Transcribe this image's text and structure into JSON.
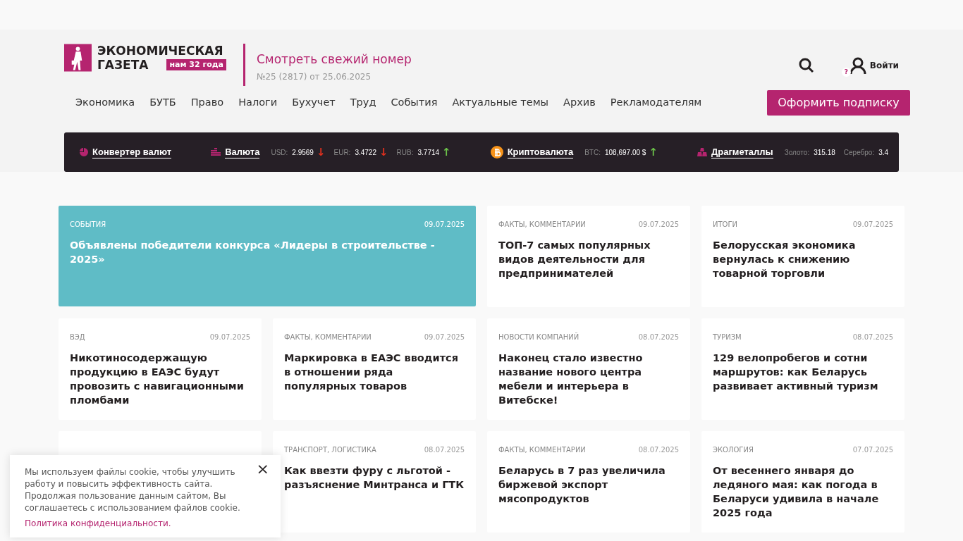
{
  "logo": {
    "line1": "ЭКОНОМИЧЕСКАЯ",
    "line2": "ГАЗЕТА",
    "badge": "нам 32 года"
  },
  "issue": {
    "link": "Смотреть свежий номер",
    "number": "№25 (2817) от 25.06.2025"
  },
  "login": {
    "label": "Войти",
    "badge": "?"
  },
  "nav": [
    "Экономика",
    "БУТБ",
    "Право",
    "Налоги",
    "Бухучет",
    "Труд",
    "События",
    "Актуальные темы",
    "Архив",
    "Рекламодателям"
  ],
  "subscribe": "Оформить подписку",
  "ticker": [
    {
      "kind": "converter",
      "label": "Конвертер валют"
    },
    {
      "kind": "currency",
      "label": "Валюта",
      "quotes": [
        {
          "code": "USD:",
          "value": "2.9569",
          "arrow": "↓",
          "color": "#e0301e"
        },
        {
          "code": "EUR:",
          "value": "3.4722",
          "arrow": "↓",
          "color": "#e0301e"
        },
        {
          "code": "RUB:",
          "value": "3.7714",
          "arrow": "↑",
          "color": "#6cc24a"
        }
      ]
    },
    {
      "kind": "crypto",
      "label": "Криптовалюта",
      "quotes": [
        {
          "code": "BTC:",
          "value": "108,697.00 $",
          "arrow": "↑",
          "color": "#6cc24a"
        }
      ]
    },
    {
      "kind": "metals",
      "label": "Драгметаллы",
      "quotes": [
        {
          "code": "Золото:",
          "value": "315.18"
        },
        {
          "code": "Серебро:",
          "value": "3.4"
        }
      ]
    }
  ],
  "articles": [
    {
      "featured": true,
      "category": "СОБЫТИЯ",
      "date": "09.07.2025",
      "title": "Объявлены победители конкурса «Лидеры в строительстве - 2025»"
    },
    {
      "featured": false,
      "category": "ФАКТЫ, КОММЕНТАРИИ",
      "date": "09.07.2025",
      "title": "ТОП-7 самых популярных видов деятельности для предпринимателей"
    },
    {
      "featured": false,
      "category": "ИТОГИ",
      "date": "09.07.2025",
      "title": "Белорусская экономика вернулась к снижению товарной торговли"
    },
    {
      "featured": false,
      "category": "ВЭД",
      "date": "09.07.2025",
      "title": "Никотиносодержащую продукцию в ЕАЭС будут провозить с навигационными пломбами"
    },
    {
      "featured": false,
      "category": "ФАКТЫ, КОММЕНТАРИИ",
      "date": "09.07.2025",
      "title": "Маркировка в ЕАЭС вводится в отношении ряда популярных товаров"
    },
    {
      "featured": false,
      "category": "НОВОСТИ КОМПАНИЙ",
      "date": "08.07.2025",
      "title": "Наконец стало известно название нового центра мебели и интерьера в Витебске!"
    },
    {
      "featured": false,
      "category": "ТУРИЗМ",
      "date": "08.07.2025",
      "title": "129 велопробегов и сотни маршрутов: как Беларусь развивает активный туризм"
    },
    {
      "featured": false
    },
    {
      "featured": false,
      "category": "ТРАНСПОРТ, ЛОГИСТИКА",
      "date": "08.07.2025",
      "title": "Как ввезти фуру с льготой - разъяснение Минтранса и ГТК"
    },
    {
      "featured": false,
      "category": "ФАКТЫ, КОММЕНТАРИИ",
      "date": "08.07.2025",
      "title": "Беларусь в 7 раз увеличила биржевой экспорт мясопродуктов"
    },
    {
      "featured": false,
      "category": "ЭКОЛОГИЯ",
      "date": "07.07.2025",
      "title": "От весеннего января до ледяного мая: как погода в Беларуси удивила в начале 2025 года"
    }
  ],
  "cookie": {
    "text": "Мы используем файлы cookie, чтобы улучшить работу и повысить эффективность сайта.",
    "text2": "Продолжая пользование данным сайтом, Вы соглашаетесь с использованием файлов cookie.",
    "link": "Политика конфиденциальности.",
    "close": "×"
  }
}
